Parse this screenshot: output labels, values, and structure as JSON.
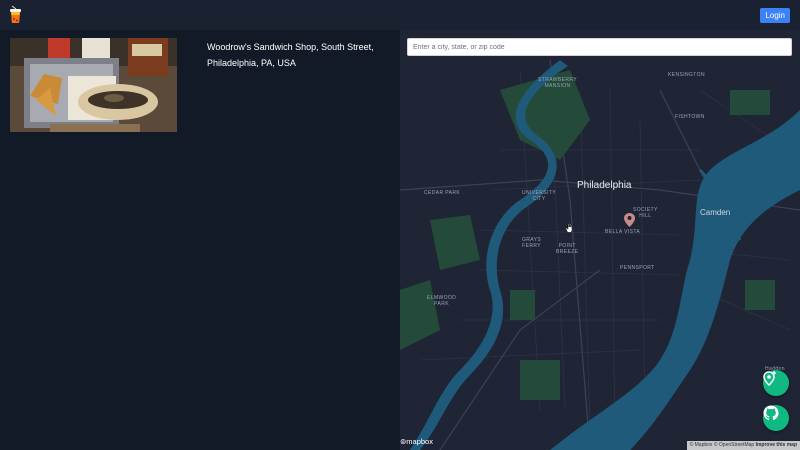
{
  "header": {
    "logo_icon": "drink-cup-icon",
    "login_label": "Login",
    "accent_color": "#3b82f6"
  },
  "results": [
    {
      "address": "Woodrow's Sandwich Shop, South Street, Philadelphia, PA, USA",
      "image": "sandwich-photo"
    }
  ],
  "map": {
    "search_placeholder": "Enter a city, state, or zip code",
    "labels": {
      "city": "Philadelphia",
      "camden": "Camden",
      "strawberry_mansion": "STRAWBERRY\nMANSION",
      "kensington": "KENSINGTON",
      "fishtown": "FISHTOWN",
      "cedar_park": "CEDAR PARK",
      "university_city": "UNIVERSITY\nCITY",
      "society_hill": "SOCIETY\nHILL",
      "bella_vista": "BELLA VISTA",
      "grays_ferry": "GRAYS\nFERRY",
      "point_breeze": "POINT\nBREEZE",
      "pennsport": "PENNSPORT",
      "elmwood_park": "ELMWOOD\nPARK",
      "haddon": "Haddon"
    },
    "brand": "mapbox",
    "attribution": {
      "mapbox": "© Mapbox",
      "osm": "© OpenStreetMap",
      "improve": "Improve this map"
    },
    "water_color": "#1f5a7a",
    "park_color": "#244a3a",
    "fab_color": "#10b981"
  }
}
